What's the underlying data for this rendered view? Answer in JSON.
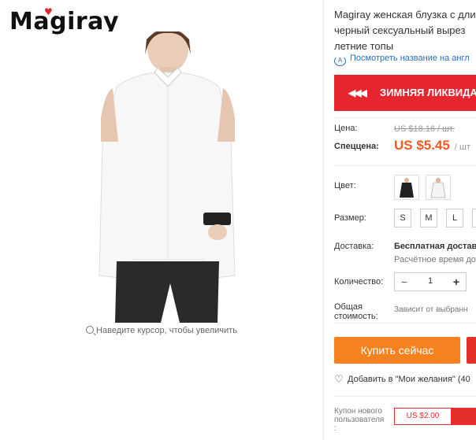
{
  "brand": {
    "logo_text": "Magiray"
  },
  "gallery": {
    "zoom_hint": "Наведите курсор, чтобы увеличить"
  },
  "product": {
    "title_lines": [
      "Magiray женская блузка с длин",
      "черный сексуальный вырез",
      "летние топы"
    ],
    "translate_link": "Посмотреть название на англ",
    "banner_text": "ЗИМНЯЯ ЛИКВИДА",
    "price_label": "Цена:",
    "old_price": "US $18.16 / шт.",
    "sale_label": "Спеццена:",
    "sale_price": "US $5.45",
    "sale_unit": "/ шт",
    "color_label": "Цвет:",
    "colors": [
      "black",
      "white"
    ],
    "size_label": "Размер:",
    "sizes": [
      "S",
      "M",
      "L",
      ""
    ],
    "shipping_label": "Доставка:",
    "shipping_free": "Бесплатная доставк",
    "shipping_estimate": "Расчётное время до",
    "qty_label": "Количество:",
    "qty_minus": "−",
    "qty_value": "1",
    "qty_plus": "+",
    "total_label_1": "Общая",
    "total_label_2": "стоимость:",
    "total_value": "Зависит от выбранн",
    "buy_button": "Купить сейчас",
    "wishlist": "Добавить в \"Мои желания\" (40",
    "coupon_label_1": "Купон нового",
    "coupon_label_2": "пользователя",
    "coupon_label_3": ":",
    "coupon_value": "US $2.00"
  },
  "colors": {
    "accent": "#f05a23",
    "buy": "#f6821f",
    "banner": "#e6262e",
    "link": "#2a6ebb"
  }
}
